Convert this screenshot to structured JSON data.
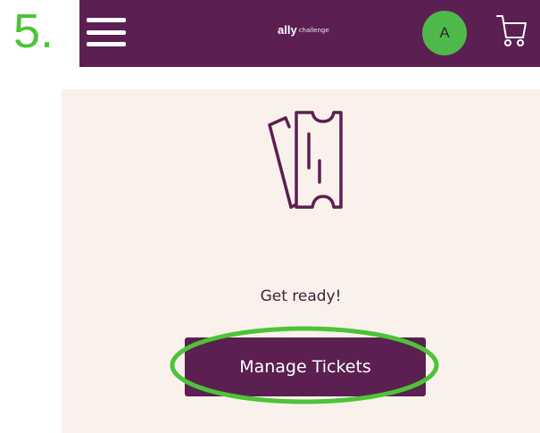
{
  "annotation": {
    "step_label": "5.",
    "highlight_color": "#4cc437"
  },
  "header": {
    "background": "#5b1f52",
    "logo": {
      "primary": "ally",
      "secondary": "challenge"
    },
    "avatar_initial": "A",
    "avatar_color": "#4fb84a",
    "icons": [
      "hamburger-menu-icon",
      "cart-icon"
    ]
  },
  "main": {
    "background": "#fbf1ec",
    "icon": "ticket-icon",
    "message": "Get ready!",
    "button_label": "Manage Tickets"
  }
}
